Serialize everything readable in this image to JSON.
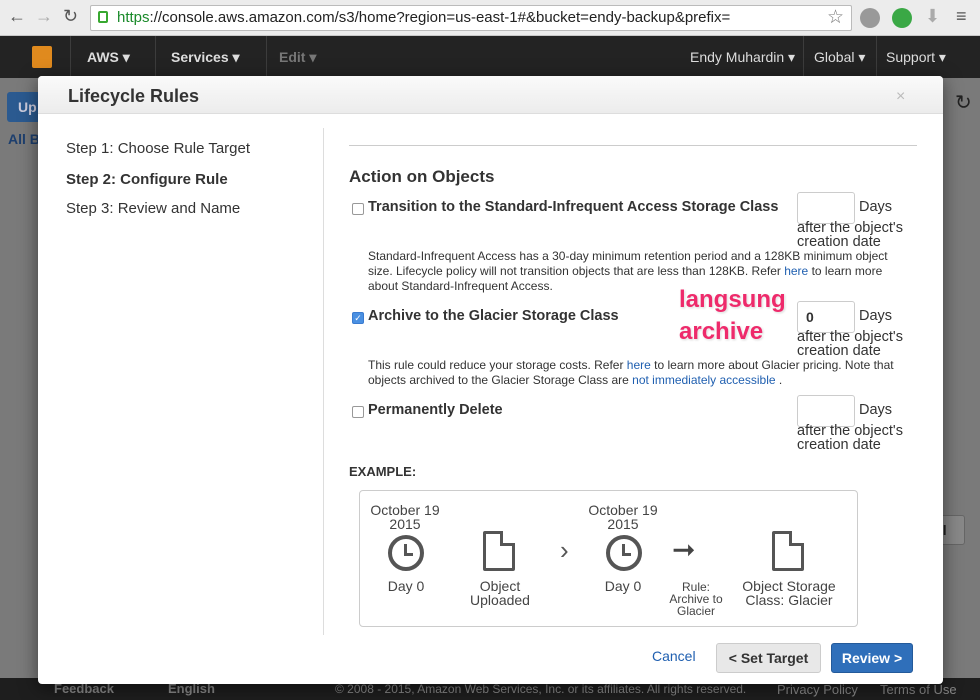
{
  "browser": {
    "url_scheme": "https",
    "url_rest": "://console.aws.amazon.com/s3/home?region=us-east-1#&bucket=endy-backup&prefix="
  },
  "awsbar": {
    "aws": "AWS",
    "services": "Services",
    "edit": "Edit",
    "user": "Endy Muhardin",
    "region": "Global",
    "support": "Support"
  },
  "background": {
    "upload_partial": "Up",
    "all_buckets_partial": "All B",
    "cancel_partial": "el"
  },
  "footer": {
    "feedback": "Feedback",
    "language": "English",
    "copyright": "© 2008 - 2015, Amazon Web Services, Inc. or its affiliates. All rights reserved.",
    "privacy": "Privacy Policy",
    "terms": "Terms of Use"
  },
  "modal": {
    "title": "Lifecycle Rules",
    "close": "×",
    "steps": [
      "Step 1: Choose Rule Target",
      "Step 2: Configure Rule",
      "Step 3: Review and Name"
    ],
    "active_step": 1,
    "section_title": "Action on Objects",
    "options": [
      {
        "label": "Transition to the Standard-Infrequent Access Storage Class",
        "checked": false,
        "days": ""
      },
      {
        "label": "Archive to the Glacier Storage Class",
        "checked": true,
        "days": "0"
      },
      {
        "label": "Permanently Delete",
        "checked": false,
        "days": ""
      }
    ],
    "days_label": "Days",
    "after_label": "after the object's creation date",
    "ia_desc_1": "Standard-Infrequent Access has a 30-day minimum retention period and a 128KB minimum object size. Lifecycle policy will not transition objects that are less than 128KB. Refer ",
    "ia_link": "here",
    "ia_desc_2": " to learn more about Standard-Infrequent Access.",
    "gl_desc_1": "This rule could reduce your storage costs. Refer ",
    "gl_link1": "here",
    "gl_desc_2": " to learn more about Glacier pricing. Note that objects archived to the Glacier Storage Class are ",
    "gl_link2": "not immediately accessible",
    "gl_desc_3": " .",
    "annotation_line1": "langsung",
    "annotation_line2": "archive",
    "example_label": "EXAMPLE:",
    "example": {
      "date1": "October 19",
      "year1": "2015",
      "day1": "Day 0",
      "uploaded": "Object Uploaded",
      "date2": "October 19",
      "year2": "2015",
      "day2": "Day 0",
      "rule": "Rule: Archive to Glacier",
      "result": "Object Storage Class: Glacier"
    },
    "cancel": "Cancel",
    "back": "< Set Target",
    "next": "Review >"
  }
}
